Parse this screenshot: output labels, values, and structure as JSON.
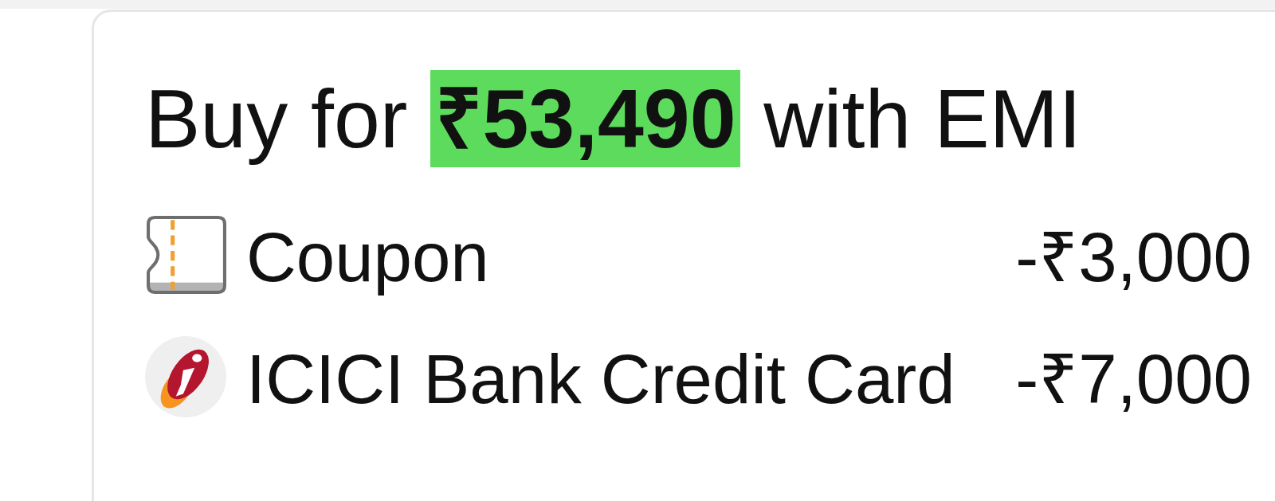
{
  "offer": {
    "title": "Buy for **₹53,490** with EMI",
    "discounts": [
      {
        "kind": "coupon",
        "label": "Coupon",
        "amount": "-₹3,000"
      },
      {
        "kind": "card",
        "label": "ICICI Bank Credit Card",
        "amount": "-₹7,000"
      }
    ]
  }
}
